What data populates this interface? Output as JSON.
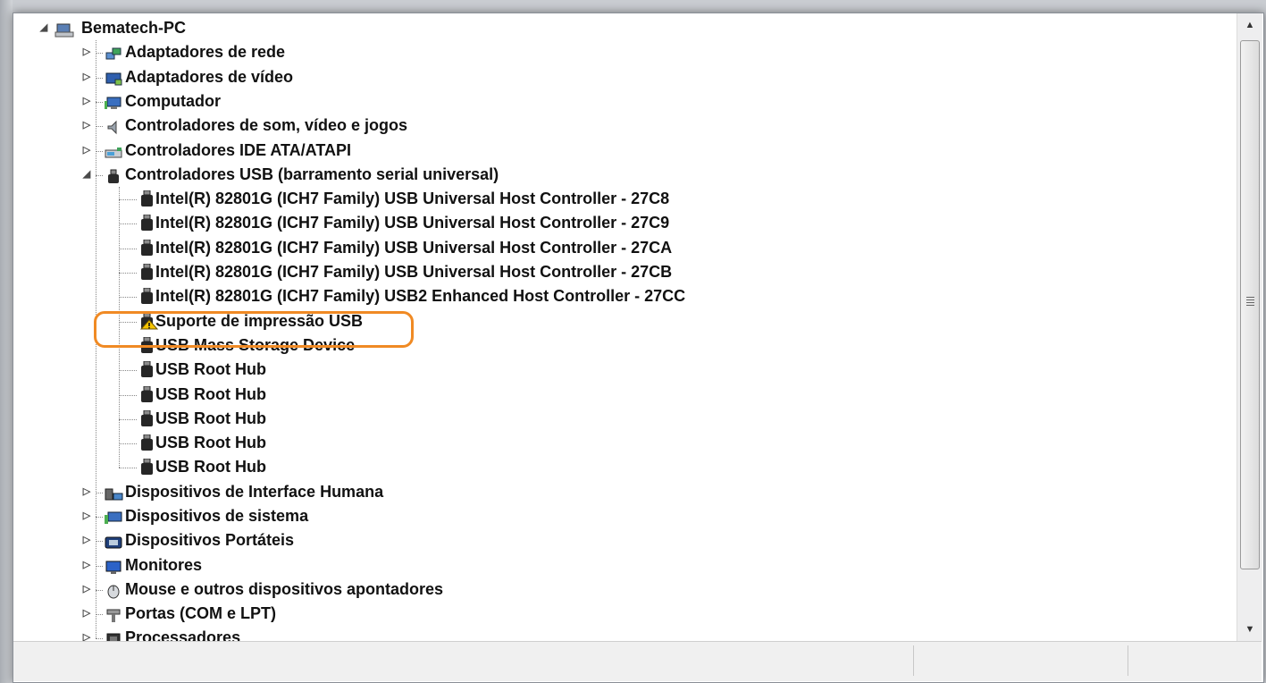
{
  "tree": {
    "root": {
      "label": "Bematech-PC",
      "icon": "computer-icon",
      "expanded": true
    },
    "items": [
      {
        "label": "Adaptadores de rede",
        "icon": "network-adapter-icon",
        "expanded": false
      },
      {
        "label": "Adaptadores de vídeo",
        "icon": "display-adapter-icon",
        "expanded": false
      },
      {
        "label": "Computador",
        "icon": "computer-monitor-icon",
        "expanded": false
      },
      {
        "label": "Controladores de som, vídeo e jogos",
        "icon": "speaker-icon",
        "expanded": false
      },
      {
        "label": "Controladores IDE ATA/ATAPI",
        "icon": "ide-controller-icon",
        "expanded": false
      },
      {
        "label": "Controladores USB (barramento serial universal)",
        "icon": "usb-icon",
        "expanded": true
      },
      {
        "label": "Dispositivos de Interface Humana",
        "icon": "hid-icon",
        "expanded": false
      },
      {
        "label": "Dispositivos de sistema",
        "icon": "system-device-icon",
        "expanded": false
      },
      {
        "label": "Dispositivos Portáteis",
        "icon": "portable-device-icon",
        "expanded": false
      },
      {
        "label": "Monitores",
        "icon": "monitor-icon",
        "expanded": false
      },
      {
        "label": "Mouse e outros dispositivos apontadores",
        "icon": "mouse-icon",
        "expanded": false
      },
      {
        "label": "Portas (COM e LPT)",
        "icon": "port-icon",
        "expanded": false
      },
      {
        "label": "Processadores",
        "icon": "processor-icon",
        "expanded": false
      }
    ],
    "usb_children": [
      {
        "label": "Intel(R) 82801G (ICH7 Family) USB Universal Host Controller - 27C8",
        "warning": false
      },
      {
        "label": "Intel(R) 82801G (ICH7 Family) USB Universal Host Controller - 27C9",
        "warning": false
      },
      {
        "label": "Intel(R) 82801G (ICH7 Family) USB Universal Host Controller - 27CA",
        "warning": false
      },
      {
        "label": "Intel(R) 82801G (ICH7 Family) USB Universal Host Controller - 27CB",
        "warning": false
      },
      {
        "label": "Intel(R) 82801G (ICH7 Family) USB2 Enhanced Host Controller - 27CC",
        "warning": false
      },
      {
        "label": "Suporte de impressão USB",
        "warning": true
      },
      {
        "label": "USB Mass Storage Device",
        "warning": false
      },
      {
        "label": "USB Root Hub",
        "warning": false
      },
      {
        "label": "USB Root Hub",
        "warning": false
      },
      {
        "label": "USB Root Hub",
        "warning": false
      },
      {
        "label": "USB Root Hub",
        "warning": false
      },
      {
        "label": "USB Root Hub",
        "warning": false
      }
    ]
  },
  "glyphs": {
    "expanded": "◢",
    "collapsed": "▷",
    "scroll_up": "▲",
    "scroll_down": "▼"
  },
  "colors": {
    "highlight": "#f08a24",
    "warning": "#f5c400"
  }
}
